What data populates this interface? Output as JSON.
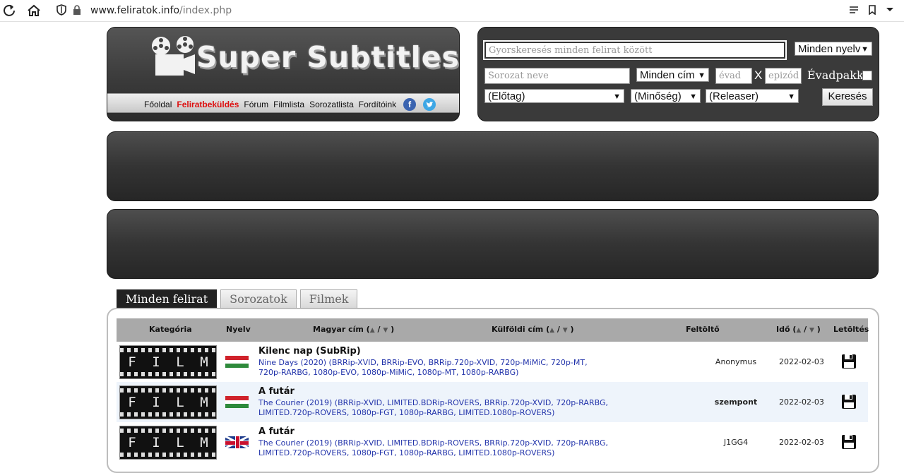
{
  "browser": {
    "url_host": "www.feliratok.info",
    "url_path": "/index.php"
  },
  "logo": {
    "text": "Super Subtitles"
  },
  "nav": {
    "items": [
      "Főoldal",
      "Feliratbeküldés",
      "Fórum",
      "Filmlista",
      "Sorozatlista",
      "Fordítóink"
    ],
    "facebook_glyph": "f",
    "twitter_glyph": "t"
  },
  "search": {
    "quick_placeholder": "Gyorskeresés minden felirat között",
    "language_select": "Minden nyelv",
    "series_placeholder": "Sorozat neve",
    "title_select": "Minden cím",
    "season_placeholder": "évad",
    "x_label": "X",
    "episode_placeholder": "epizód",
    "seasonpack_label": "Évadpakk",
    "prefix_select": "(Előtag)",
    "quality_select": "(Minőség)",
    "releaser_select": "(Releaser)",
    "search_button": "Keresés"
  },
  "tabs": [
    "Minden felirat",
    "Sorozatok",
    "Filmek"
  ],
  "table": {
    "headers": {
      "category": "Kategória",
      "language": "Nyelv",
      "hungarian_title": "Magyar cím (",
      "foreign_title": "Külföldi cím (",
      "uploader": "Feltöltő",
      "time": "Idő (",
      "download": "Letöltés"
    },
    "sort_suffix": " / ",
    "sort_close": " )",
    "rows": [
      {
        "category": "FILM",
        "language": "hungarian",
        "title": "Kilenc nap (SubRip)",
        "subtitle": "Nine Days (2020) (BRRip-XVID, BRRip-EVO, BRRip.720p-XVID, 720p-MiMiC, 720p-MT, 720p-RARBG, 1080p-EVO, 1080p-MiMiC, 1080p-MT, 1080p-RARBG)",
        "uploader": "Anonymus",
        "date": "2022-02-03"
      },
      {
        "category": "FILM",
        "language": "hungarian",
        "title": "A futár",
        "subtitle": "The Courier (2019) (BRRip-XVID, LIMITED.BDRip-ROVERS, BRRip.720p-XVID, 720p-RARBG, LIMITED.720p-ROVERS, 1080p-FGT, 1080p-RARBG, LIMITED.1080p-ROVERS)",
        "uploader": "szempont",
        "date": "2022-02-03"
      },
      {
        "category": "FILM",
        "language": "english",
        "title": "A futár",
        "subtitle": "The Courier (2019) (BRRip-XVID, LIMITED.BDRip-ROVERS, BRRip.720p-XVID, 720p-RARBG, LIMITED.720p-ROVERS, 1080p-FGT, 1080p-RARBG, LIMITED.1080p-ROVERS)",
        "uploader": "J1GG4",
        "date": "2022-02-03"
      }
    ]
  }
}
